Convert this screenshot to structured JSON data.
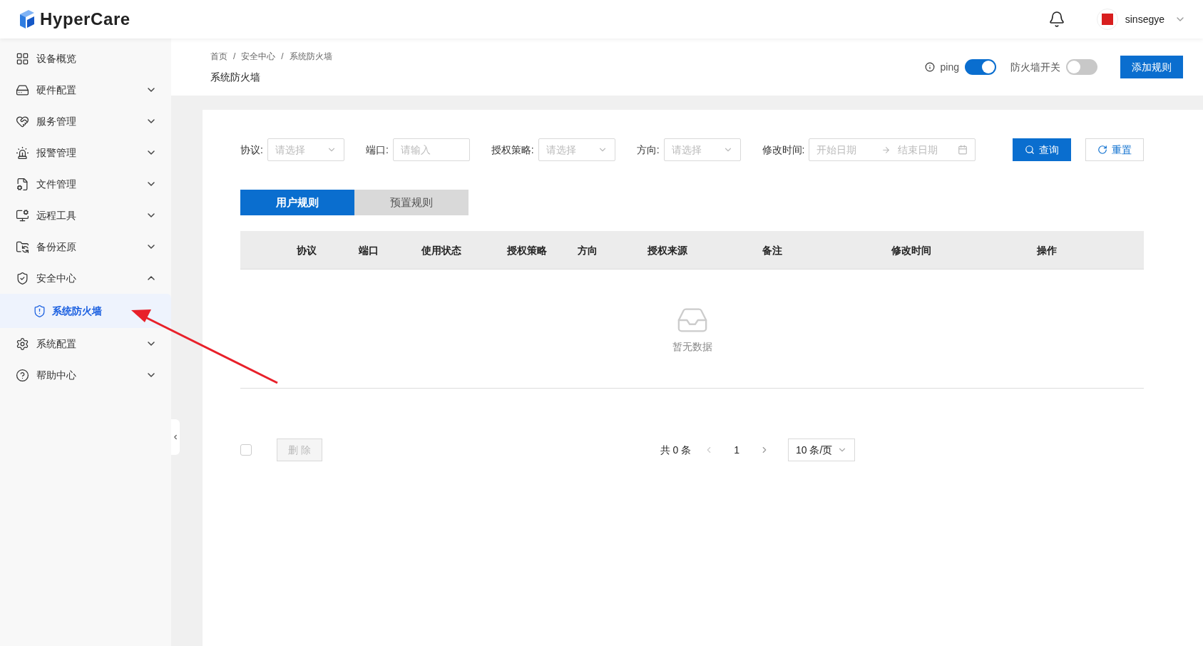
{
  "header": {
    "logo_text": "HyperCare",
    "user": {
      "name": "sinsegye"
    }
  },
  "sidebar": {
    "items": [
      {
        "kind": "link",
        "label": "设备概览"
      },
      {
        "kind": "group",
        "label": "硬件配置",
        "expanded": false
      },
      {
        "kind": "group",
        "label": "服务管理",
        "expanded": false
      },
      {
        "kind": "group",
        "label": "报警管理",
        "expanded": false
      },
      {
        "kind": "group",
        "label": "文件管理",
        "expanded": false
      },
      {
        "kind": "group",
        "label": "远程工具",
        "expanded": false
      },
      {
        "kind": "group",
        "label": "备份还原",
        "expanded": false
      },
      {
        "kind": "group",
        "label": "安全中心",
        "expanded": true,
        "children": [
          {
            "label": "系统防火墙",
            "selected": true
          }
        ]
      },
      {
        "kind": "group",
        "label": "系统配置",
        "expanded": false
      },
      {
        "kind": "group",
        "label": "帮助中心",
        "expanded": false
      }
    ]
  },
  "breadcrumb": {
    "separator": "/",
    "items": [
      "首页",
      "安全中心",
      "系统防火墙"
    ]
  },
  "page_title": "系统防火墙",
  "toggles": [
    {
      "label": "ping",
      "info": true,
      "on": true
    },
    {
      "label": "防火墙开关",
      "info": false,
      "on": false
    }
  ],
  "add_button": "添加规则",
  "filters": [
    {
      "kind": "select",
      "label": "协议:",
      "placeholder": "请选择"
    },
    {
      "kind": "input",
      "label": "端口:",
      "placeholder": "请输入"
    },
    {
      "kind": "select",
      "label": "授权策略:",
      "placeholder": "请选择"
    },
    {
      "kind": "select",
      "label": "方向:",
      "placeholder": "请选择"
    },
    {
      "kind": "daterange",
      "label": "修改时间:",
      "placeholder": "开始日期",
      "placeholder_end": "结束日期"
    }
  ],
  "query_button": "查询",
  "reset_button": "重置",
  "tabs": [
    {
      "label": "用户规则",
      "selected": true
    },
    {
      "label": "预置规则",
      "selected": false
    }
  ],
  "table": {
    "columns": [
      "协议",
      "端口",
      "使用状态",
      "授权策略",
      "方向",
      "授权来源",
      "备注",
      "修改时间",
      "操作"
    ],
    "empty_text": "暂无数据"
  },
  "footer": {
    "select_all": {
      "checked": false
    },
    "delete_button": {
      "label": "删 除",
      "disabled": true
    },
    "total": "共 0 条",
    "pages": [
      {
        "label": "1",
        "selected": true
      }
    ],
    "page_size": "10 条/页"
  }
}
